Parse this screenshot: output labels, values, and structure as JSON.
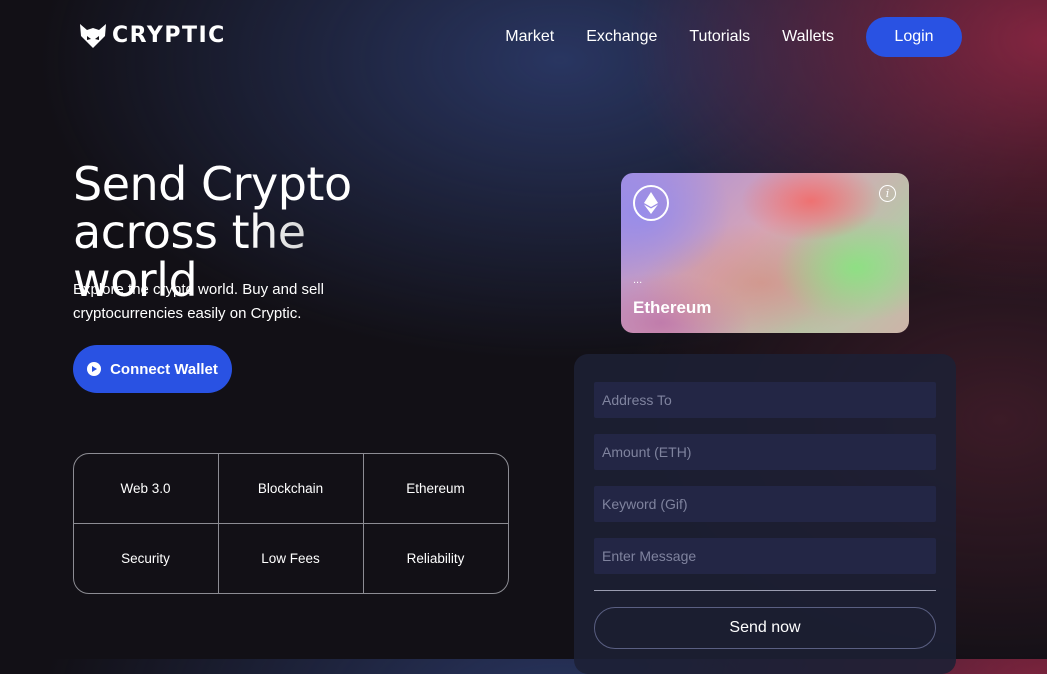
{
  "header": {
    "logo_text": "CRYPTIC",
    "nav": [
      {
        "label": "Market"
      },
      {
        "label": "Exchange"
      },
      {
        "label": "Tutorials"
      },
      {
        "label": "Wallets"
      }
    ],
    "login_label": "Login"
  },
  "hero": {
    "title_line1": "Send Crypto",
    "title_line2": "across the world",
    "subtitle": "Explore the crypto world. Buy and sell cryptocurrencies easily on Cryptic.",
    "connect_label": "Connect Wallet"
  },
  "features": [
    {
      "label": "Web 3.0"
    },
    {
      "label": "Blockchain"
    },
    {
      "label": "Ethereum"
    },
    {
      "label": "Security"
    },
    {
      "label": "Low Fees"
    },
    {
      "label": "Reliability"
    }
  ],
  "card": {
    "address": "...",
    "network": "Ethereum",
    "info_glyph": "i",
    "icons": [
      "ethereum-icon",
      "info-icon"
    ]
  },
  "form": {
    "address_placeholder": "Address To",
    "amount_placeholder": "Amount (ETH)",
    "keyword_placeholder": "Keyword (Gif)",
    "message_placeholder": "Enter Message",
    "send_label": "Send now"
  },
  "colors": {
    "accent": "#2952e3",
    "background": "#121016",
    "input_background": "#232645"
  }
}
